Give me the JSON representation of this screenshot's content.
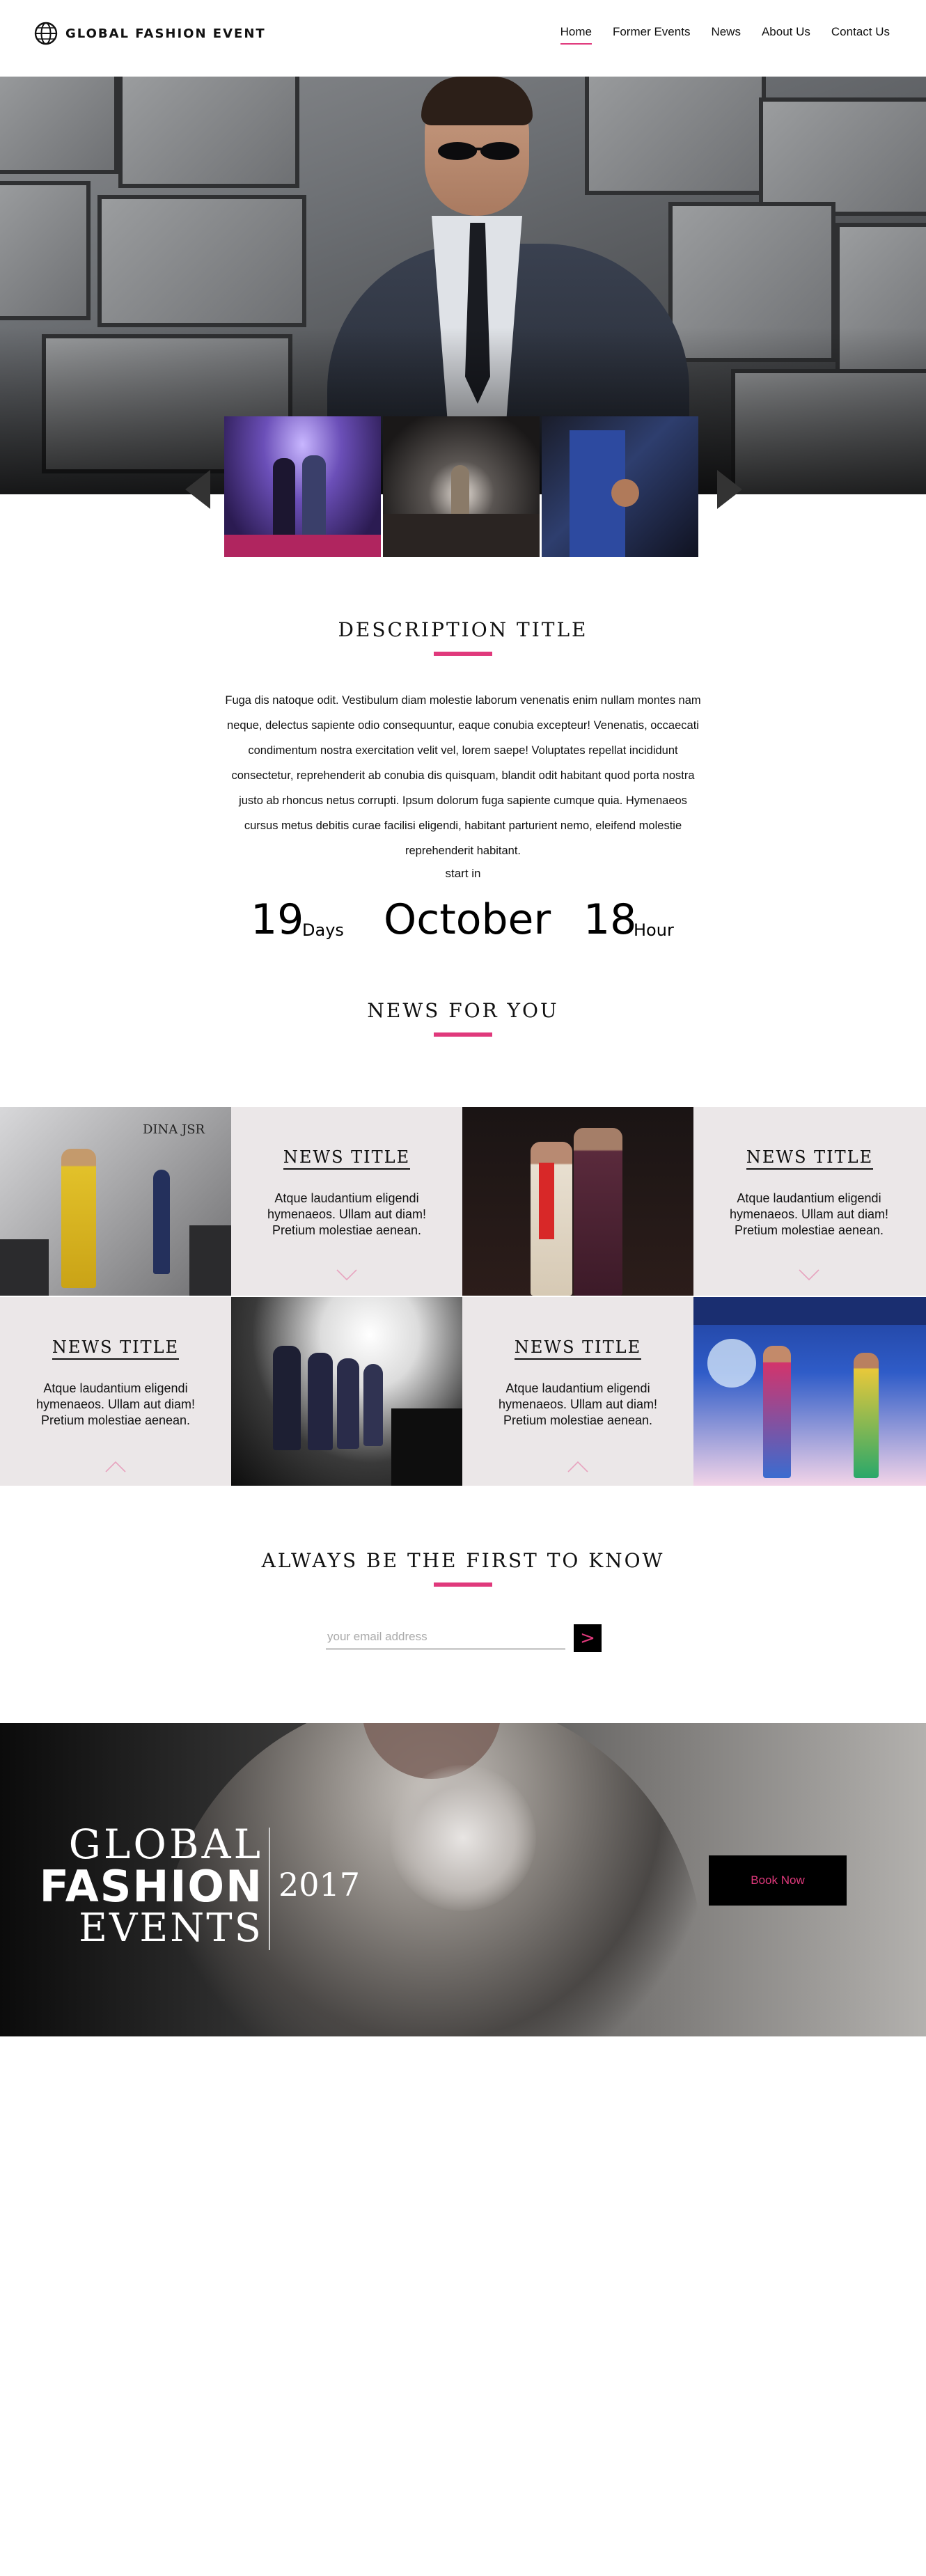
{
  "header": {
    "logo_text": "GLOBAL FASHION EVENT",
    "nav": [
      {
        "label": "Home",
        "active": true
      },
      {
        "label": "Former Events",
        "active": false
      },
      {
        "label": "News",
        "active": false
      },
      {
        "label": "About Us",
        "active": false
      },
      {
        "label": "Contact Us",
        "active": false
      }
    ]
  },
  "description": {
    "title": "DESCRIPTION TITLE",
    "body": "Fuga dis natoque odit. Vestibulum diam molestie laborum venenatis enim nullam montes nam neque, delectus sapiente odio consequuntur, eaque conubia excepteur! Venenatis, occaecati condimentum nostra exercitation velit vel, lorem saepe! Voluptates repellat incididunt consectetur, reprehenderit ab conubia dis quisquam, blandit odit habitant quod porta nostra justo ab rhoncus netus corrupti. Ipsum dolorum fuga sapiente cumque quia. Hymenaeos cursus metus debitis curae facilisi eligendi, habitant parturient nemo, eleifend molestie reprehenderit habitant.",
    "start_in": "start in",
    "countdown": {
      "days_value": "19",
      "days_label": "Days",
      "month": "October",
      "hour_value": "18",
      "hour_label": "Hour"
    }
  },
  "news": {
    "title": "NEWS FOR YOU",
    "items": [
      {
        "title": "NEWS TITLE",
        "text": "Atque laudantium eligendi hymenaeos. Ullam aut diam! Pretium molestiae aenean."
      },
      {
        "title": "NEWS TITLE",
        "text": "Atque laudantium eligendi hymenaeos. Ullam aut diam! Pretium molestiae aenean."
      },
      {
        "title": "NEWS TITLE",
        "text": "Atque laudantium eligendi hymenaeos. Ullam aut diam! Pretium molestiae aenean."
      },
      {
        "title": "NEWS TITLE",
        "text": "Atque laudantium eligendi hymenaeos. Ullam aut diam! Pretium molestiae aenean."
      }
    ],
    "photo_caption": "DINA JSR"
  },
  "newsletter": {
    "title": "ALWAYS BE THE FIRST TO KNOW",
    "placeholder": "your email address",
    "submit_label": ">"
  },
  "banner": {
    "line1": "GLOBAL",
    "line2": "FASHION",
    "line3": "EVENTS",
    "year": "2017",
    "book_label": "Book Now"
  },
  "colors": {
    "accent": "#e0397c",
    "news_cell_bg": "#ebe7e8",
    "text": "#111111"
  }
}
